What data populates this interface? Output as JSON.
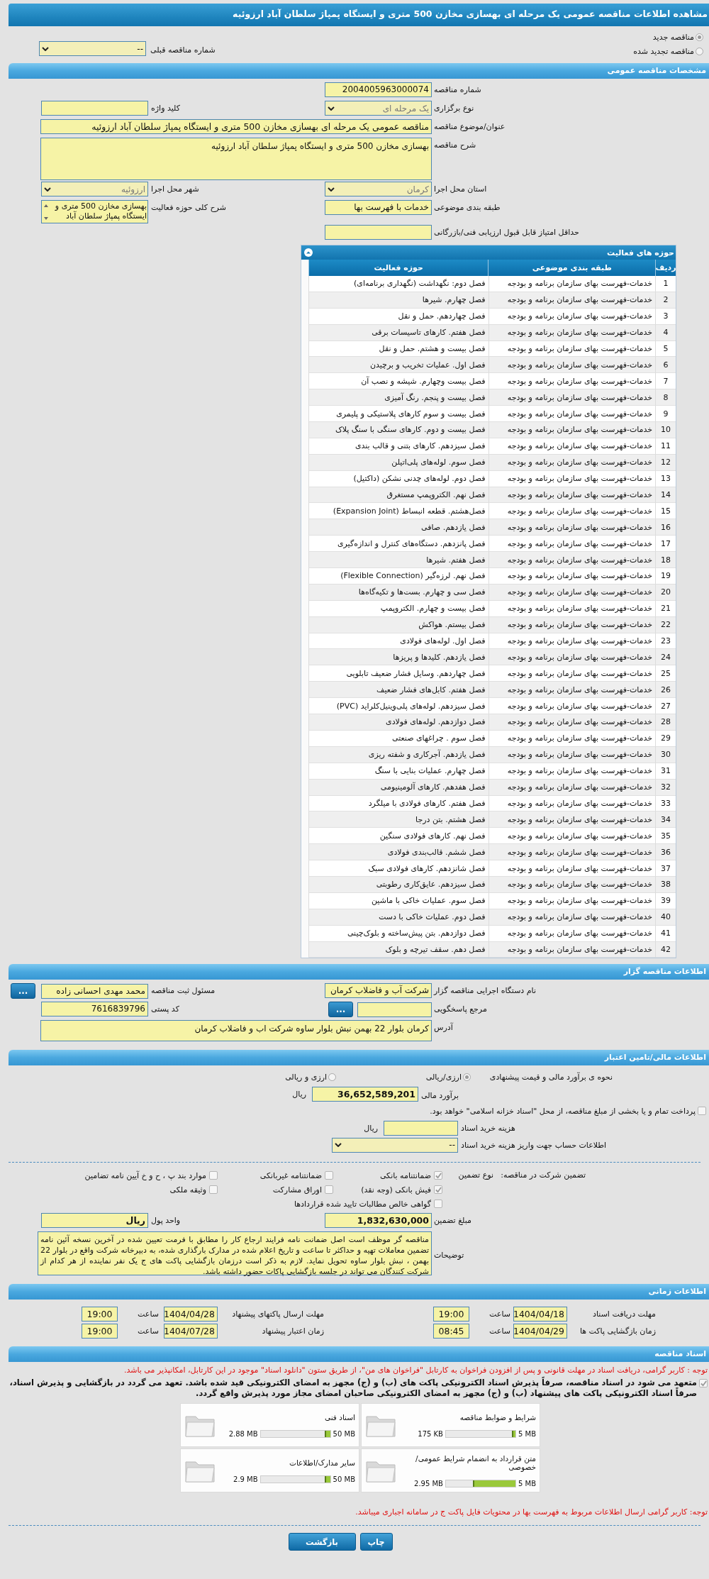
{
  "title": "مشاهده اطلاعات مناقصه عمومی یک مرحله ای بهسازی مخازن 500 متری و ایستگاه پمپاژ سلطان آباد ارزوئیه",
  "tender_mode": [
    {
      "label": "مناقصه جدید",
      "selected": true
    },
    {
      "label": "مناقصه تجدید شده",
      "selected": false
    }
  ],
  "previous_tender": {
    "label": "شماره مناقصه قبلی",
    "value": "--"
  },
  "general": {
    "header": "مشخصات مناقصه عمومی",
    "rows": [
      {
        "right": {
          "label": "شماره مناقصه",
          "kind": "input",
          "value": "2004005963000074"
        }
      },
      {
        "right": {
          "label": "نوع برگزاری",
          "kind": "select",
          "value": "یک مرحله ای"
        },
        "left": {
          "label": "کلید واژه",
          "kind": "input"
        }
      },
      {
        "full": {
          "label": "عنوان/موضوع مناقصه",
          "kind": "input",
          "value": "مناقصه عمومی یک مرحله ای بهسازی مخازن 500 متری و ایستگاه پمپاژ سلطان آباد ارزوئیه"
        }
      },
      {
        "full": {
          "label": "شرح مناقصه",
          "kind": "textarea",
          "value": "بهسازی مخازن 500 متری و ایستگاه پمپاژ سلطان آباد ارزوئیه"
        }
      },
      {
        "right": {
          "label": "استان محل اجرا",
          "kind": "select",
          "value": "کرمان"
        },
        "left": {
          "label": "شهر محل اجرا",
          "kind": "select",
          "value": "ارزوئیه"
        }
      },
      {
        "right": {
          "label": "طبقه بندی موضوعی",
          "kind": "input",
          "value": "خدمات با فهرست بها"
        },
        "left": {
          "label": "شرح کلی حوزه فعالیت",
          "kind": "scroll",
          "value": "بهسازی مخازن 500 متری و ایستگاه پمپاژ سلطان آباد"
        }
      },
      {
        "right": {
          "label": "حداقل امتیاز قابل قبول ارزیابی فنی/بازرگانی",
          "kind": "input"
        }
      }
    ]
  },
  "activities": {
    "title": "حوزه های فعالیت",
    "columns": [
      "ردیف",
      "طبقه بندی موضوعی",
      "حوزه فعالیت"
    ],
    "rows": [
      [
        "1",
        "خدمات-فهرست بهای سازمان برنامه و بودجه",
        "فصل دوم: نگهداشت (نگهداری برنامه‌ای)"
      ],
      [
        "2",
        "خدمات-فهرست بهای سازمان برنامه و بودجه",
        "فصل چهارم. شیرها"
      ],
      [
        "3",
        "خدمات-فهرست بهای سازمان برنامه و بودجه",
        "فصل چهاردهم. حمل و نقل"
      ],
      [
        "4",
        "خدمات-فهرست بهای سازمان برنامه و بودجه",
        "فصل هفتم. کارهای تاسیسات برقی"
      ],
      [
        "5",
        "خدمات-فهرست بهای سازمان برنامه و بودجه",
        "فصل بیست و هشتم. حمل و نقل"
      ],
      [
        "6",
        "خدمات-فهرست بهای سازمان برنامه و بودجه",
        "فصل اول. عملیات تخریب و برچیدن"
      ],
      [
        "7",
        "خدمات-فهرست بهای سازمان برنامه و بودجه",
        "فصل بیست وچهارم. شیشه و نصب آن"
      ],
      [
        "8",
        "خدمات-فهرست بهای سازمان برنامه و بودجه",
        "فصل بیست و پنجم. رنگ آمیزی"
      ],
      [
        "9",
        "خدمات-فهرست بهای سازمان برنامه و بودجه",
        "فصل بیست و سوم کارهای پلاستیکی و پلیمری"
      ],
      [
        "10",
        "خدمات-فهرست بهای سازمان برنامه و بودجه",
        "فصل بیست و دوم. کارهای سنگی با سنگ پلاک"
      ],
      [
        "11",
        "خدمات-فهرست بهای سازمان برنامه و بودجه",
        "فصل سیزدهم. کارهای بتنی و قالب بندی"
      ],
      [
        "12",
        "خدمات-فهرست بهای سازمان برنامه و بودجه",
        "فصل سوم. لوله‌های پلی‌اتیلن"
      ],
      [
        "13",
        "خدمات-فهرست بهای سازمان برنامه و بودجه",
        "فصل دوم. لوله‌های چدنی نشکن (داکتیل)"
      ],
      [
        "14",
        "خدمات-فهرست بهای سازمان برنامه و بودجه",
        "فصل نهم. الکتروپمپ مستغرق"
      ],
      [
        "15",
        "خدمات-فهرست بهای سازمان برنامه و بودجه",
        "فصل‌هشتم. قطعه انبساط (Expansion Joint)"
      ],
      [
        "16",
        "خدمات-فهرست بهای سازمان برنامه و بودجه",
        "فصل یازدهم. صافی"
      ],
      [
        "17",
        "خدمات-فهرست بهای سازمان برنامه و بودجه",
        "فصل پانزدهم. دستگاه‌های کنترل و اندازه‌گیری"
      ],
      [
        "18",
        "خدمات-فهرست بهای سازمان برنامه و بودجه",
        "فصل هفتم. شیرها"
      ],
      [
        "19",
        "خدمات-فهرست بهای سازمان برنامه و بودجه",
        "فصل نهم. لرزه‌گیر (Flexible Connection)"
      ],
      [
        "20",
        "خدمات-فهرست بهای سازمان برنامه و بودجه",
        "فصل سی و چهارم. بست‌ها و تکیه‌گاه‌ها"
      ],
      [
        "21",
        "خدمات-فهرست بهای سازمان برنامه و بودجه",
        "فصل بیست و چهارم. الکتروپمپ"
      ],
      [
        "22",
        "خدمات-فهرست بهای سازمان برنامه و بودجه",
        "فصل بیستم. هواکش"
      ],
      [
        "23",
        "خدمات-فهرست بهای سازمان برنامه و بودجه",
        "فصل اول. لوله‌های فولادی"
      ],
      [
        "24",
        "خدمات-فهرست بهای سازمان برنامه و بودجه",
        "فصل یازدهم. کلیدها و پریزها"
      ],
      [
        "25",
        "خدمات-فهرست بهای سازمان برنامه و بودجه",
        "فصل چهاردهم. وسایل فشار ضعیف تابلویی"
      ],
      [
        "26",
        "خدمات-فهرست بهای سازمان برنامه و بودجه",
        "فصل هفتم. کابل‌های فشار ضعیف"
      ],
      [
        "27",
        "خدمات-فهرست بهای سازمان برنامه و بودجه",
        "فصل سیزدهم. لوله‌های پلی‌وینیل‌کلراید (PVC)"
      ],
      [
        "28",
        "خدمات-فهرست بهای سازمان برنامه و بودجه",
        "فصل دوازدهم. لوله‌های فولادی"
      ],
      [
        "29",
        "خدمات-فهرست بهای سازمان برنامه و بودجه",
        "فصل سوم . چراغهای صنعتی"
      ],
      [
        "30",
        "خدمات-فهرست بهای سازمان برنامه و بودجه",
        "فصل یازدهم. آجرکاری و شفته ریزی"
      ],
      [
        "31",
        "خدمات-فهرست بهای سازمان برنامه و بودجه",
        "فصل چهارم. عملیات بنایی با سنگ"
      ],
      [
        "32",
        "خدمات-فهرست بهای سازمان برنامه و بودجه",
        "فصل هفدهم. کارهای آلومینیومی"
      ],
      [
        "33",
        "خدمات-فهرست بهای سازمان برنامه و بودجه",
        "فصل هفتم. کارهای فولادی با میلگرد"
      ],
      [
        "34",
        "خدمات-فهرست بهای سازمان برنامه و بودجه",
        "فصل هشتم. بتن درجا"
      ],
      [
        "35",
        "خدمات-فهرست بهای سازمان برنامه و بودجه",
        "فصل نهم. کارهای فولادی سنگین"
      ],
      [
        "36",
        "خدمات-فهرست بهای سازمان برنامه و بودجه",
        "فصل ششم. قالب‌بندی فولادی"
      ],
      [
        "37",
        "خدمات-فهرست بهای سازمان برنامه و بودجه",
        "فصل شانزدهم. کارهای فولادی سبک"
      ],
      [
        "38",
        "خدمات-فهرست بهای سازمان برنامه و بودجه",
        "فصل سیزدهم. عایق‌کاری رطوبتی"
      ],
      [
        "39",
        "خدمات-فهرست بهای سازمان برنامه و بودجه",
        "فصل سوم. عملیات خاکی با ماشین"
      ],
      [
        "40",
        "خدمات-فهرست بهای سازمان برنامه و بودجه",
        "فصل دوم. عملیات خاکی با دست"
      ],
      [
        "41",
        "خدمات-فهرست بهای سازمان برنامه و بودجه",
        "فصل دوازدهم. بتن پیش‌ساخته و بلوک‌چینی"
      ],
      [
        "42",
        "خدمات-فهرست بهای سازمان برنامه و بودجه",
        "فصل دهم. سقف تیرچه و بلوک"
      ]
    ]
  },
  "organizer": {
    "header": "اطلاعات مناقصه گزار",
    "rows": [
      {
        "right": {
          "label": "نام دستگاه اجرایی مناقصه گزار",
          "kind": "input",
          "value": "شرکت آب و فاضلاب کرمان"
        },
        "left": {
          "label": "مسئول ثبت مناقصه",
          "kind": "input_button",
          "value": "محمد مهدی احسانی زاده",
          "button": "..."
        }
      },
      {
        "right": {
          "label": "مرجع پاسخگویی",
          "kind": "input_button",
          "button": "..."
        },
        "left": {
          "label": "کد پستی",
          "kind": "input",
          "value": "7616839796"
        }
      },
      {
        "full": {
          "label": "آدرس",
          "kind": "textarea",
          "value": "کرمان بلوار 22 بهمن نبش بلوار ساوه شرکت اب و فاضلاب کرمان"
        }
      }
    ]
  },
  "finance": {
    "header": "اطلاعات مالی/تامین اعتبار",
    "estimate_method": {
      "label": "نحوه ی برآورد مالی و قیمت پیشنهادی",
      "options": [
        {
          "label": "ارزی/ریالی",
          "selected": true
        },
        {
          "label": "ارزی و ریالی",
          "selected": false
        }
      ]
    },
    "estimate": {
      "label": "برآورد مالی",
      "value": "36,652,589,201",
      "unit": "ریال"
    },
    "treasury": {
      "label": "پرداخت تمام و یا بخشی از مبلغ مناقصه، از محل \"اسناد خزانه اسلامی\" خواهد بود.",
      "checked": false
    },
    "doc_fee": {
      "label": "هزینه خرید اسناد",
      "unit": "ریال"
    },
    "account": {
      "label": "اطلاعات حساب جهت واریز هزینه خرید اسناد",
      "value": "--"
    },
    "guarantee": {
      "label": "تضمین شرکت در مناقصه:",
      "type_label": "نوع تضمین",
      "options": [
        {
          "label": "ضمانتنامه بانکی",
          "checked": true
        },
        {
          "label": "ضمانتنامه غیربانکی",
          "checked": false
        },
        {
          "label": "موارد بند پ ، ح و خ آیین نامه تضامین",
          "checked": false
        },
        {
          "label": "فیش بانکی (وجه نقد)",
          "checked": true
        },
        {
          "label": "اوراق مشارکت",
          "checked": false
        },
        {
          "label": "وثیقه ملکی",
          "checked": false
        },
        {
          "label": "گواهی خالص مطالبات تایید شده قراردادها",
          "checked": false
        }
      ]
    },
    "rows": [
      {
        "right": {
          "label": "مبلغ تضمین",
          "kind": "input",
          "value": "1,832,630,000"
        },
        "left": {
          "label": "واحد پول",
          "kind": "input",
          "value": "ریال"
        }
      },
      {
        "full": {
          "label": "توضیحات",
          "kind": "notes",
          "value": "مناقصه گر موظف است اصل ضمانت نامه فرایند ارجاع کار را مطابق با فرمت تعیین شده در آخرین نسخه آئین نامه تضمین معاملات  تهیه و حداکثر تا ساعت و تاریخ اعلام شده در مدارک بارگذاری شده،  به  دبیرخانه شرکت واقع در بلوار 22 بهمن ، نبش بلوار ساوه تحویل نماید. لازم به ذکر است   درزمان   بازگشایی پاکت های  ج  یک نفر نماینده از هر کدام از شرکت کنندگان  می تواند  در جلسه بازگشایی پاکات حضور داشته باشد."
        }
      }
    ]
  },
  "timing": {
    "header": "اطلاعات زمانی",
    "rows": [
      [
        {
          "label": "مهلت دریافت اسناد",
          "date": "1404/04/18",
          "time_label": "ساعت",
          "time": "19:00"
        },
        {
          "label": "مهلت ارسال پاکتهای پیشنهاد",
          "date": "1404/04/28",
          "time_label": "ساعت",
          "time": "19:00"
        }
      ],
      [
        {
          "label": "زمان بازگشایی پاکت ها",
          "date": "1404/04/29",
          "time_label": "ساعت",
          "time": "08:45"
        },
        {
          "label": "زمان اعتبار پیشنهاد",
          "date": "1404/07/28",
          "time_label": "ساعت",
          "time": "19:00"
        }
      ]
    ]
  },
  "documents": {
    "header": "اسناد مناقصه",
    "notice": "توجه : کاربر گرامی، دریافت اسناد در مهلت قانونی و پس از افزودن فراخوان به کارتابل \"فراخوان های من\"، از طریق ستون \"دانلود اسناد\" موجود در این کارتابل، امکانپذیر می باشد.",
    "commitment": {
      "label": "متعهد می شود در اسناد مناقصه، صرفاً پذیرش اسناد الکترونیکی پاکت های (ب) و (ج) مجهز به امضای الکترونیکی قید شده باشد. تعهد می گردد در بازگشایی و پذیرش اسناد، صرفاً اسناد الکترونیکی پاکت های پیشنهاد (ب) و (ج) مجهز به امضای الکترونیکی صاحبان امضای مجاز مورد پذیرش واقع گردد.",
      "checked": true
    },
    "files": [
      {
        "name": "شرایط و ضوابط مناقصه",
        "used": "175 KB",
        "max": "5 MB",
        "level": 0.034
      },
      {
        "name": "اسناد فنی",
        "used": "2.88 MB",
        "max": "50 MB",
        "level": 0.058
      },
      {
        "name": "متن قرارداد به انضمام شرایط عمومی/خصوصی",
        "used": "2.95 MB",
        "max": "5 MB",
        "level": 0.59
      },
      {
        "name": "سایر مدارک/اطلاعات",
        "used": "2.9 MB",
        "max": "50 MB",
        "level": 0.058
      }
    ],
    "footer_notice": "توجه: کاربر گرامی ارسال اطلاعات مربوط به فهرست بها در محتویات فایل پاکت ج در سامانه اجباری میباشد."
  },
  "buttons": [
    {
      "label": "چاپ"
    },
    {
      "label": "بازگشت"
    }
  ]
}
